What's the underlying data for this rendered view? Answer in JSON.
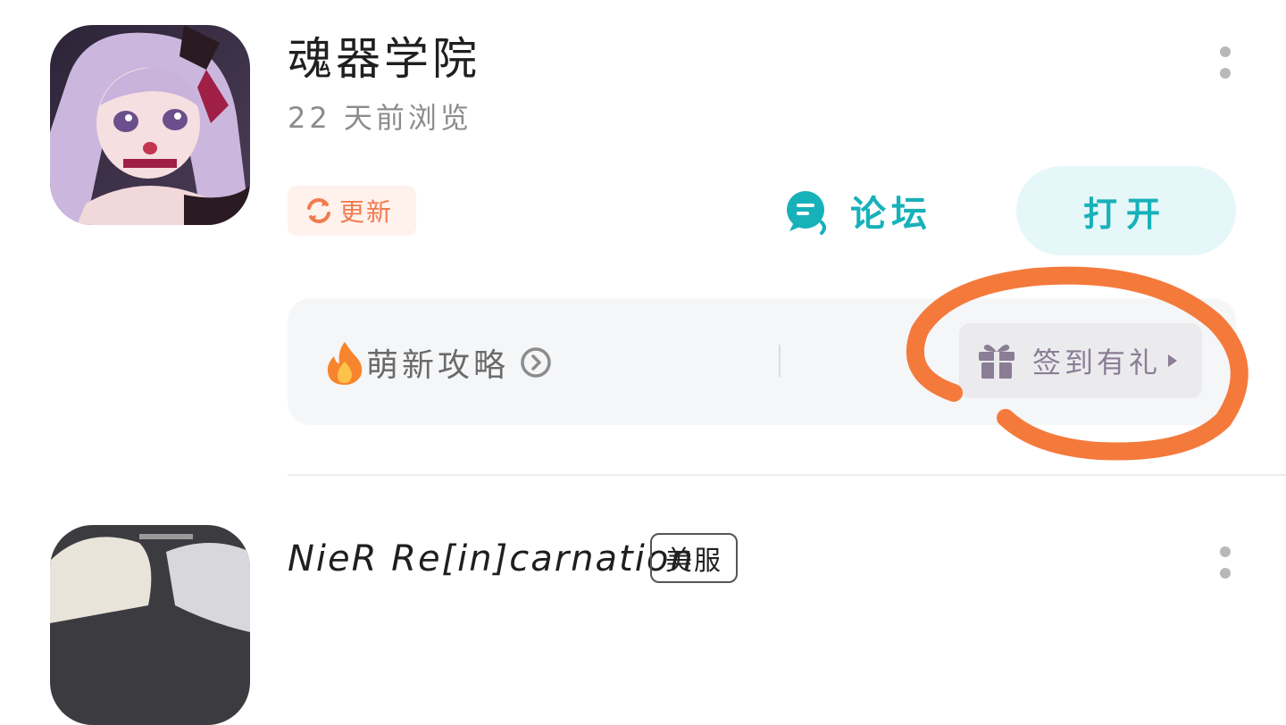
{
  "apps": [
    {
      "title": "魂器学院",
      "subtitle": "22 天前浏览",
      "update_label": "更新",
      "forum_label": "论坛",
      "open_label": "打开",
      "guide_label": "萌新攻略",
      "signin_label": "签到有礼",
      "icon_image": "anime-girl-portrait"
    },
    {
      "title": "NieR Re[in]carnation",
      "tag": "美服",
      "icon_image": "anime-character-portrait"
    }
  ],
  "colors": {
    "accent_teal": "#17b1b9",
    "update_orange": "#f07c4e",
    "annotation_orange": "#f47a3c",
    "signin_purple": "#8a7d95"
  }
}
